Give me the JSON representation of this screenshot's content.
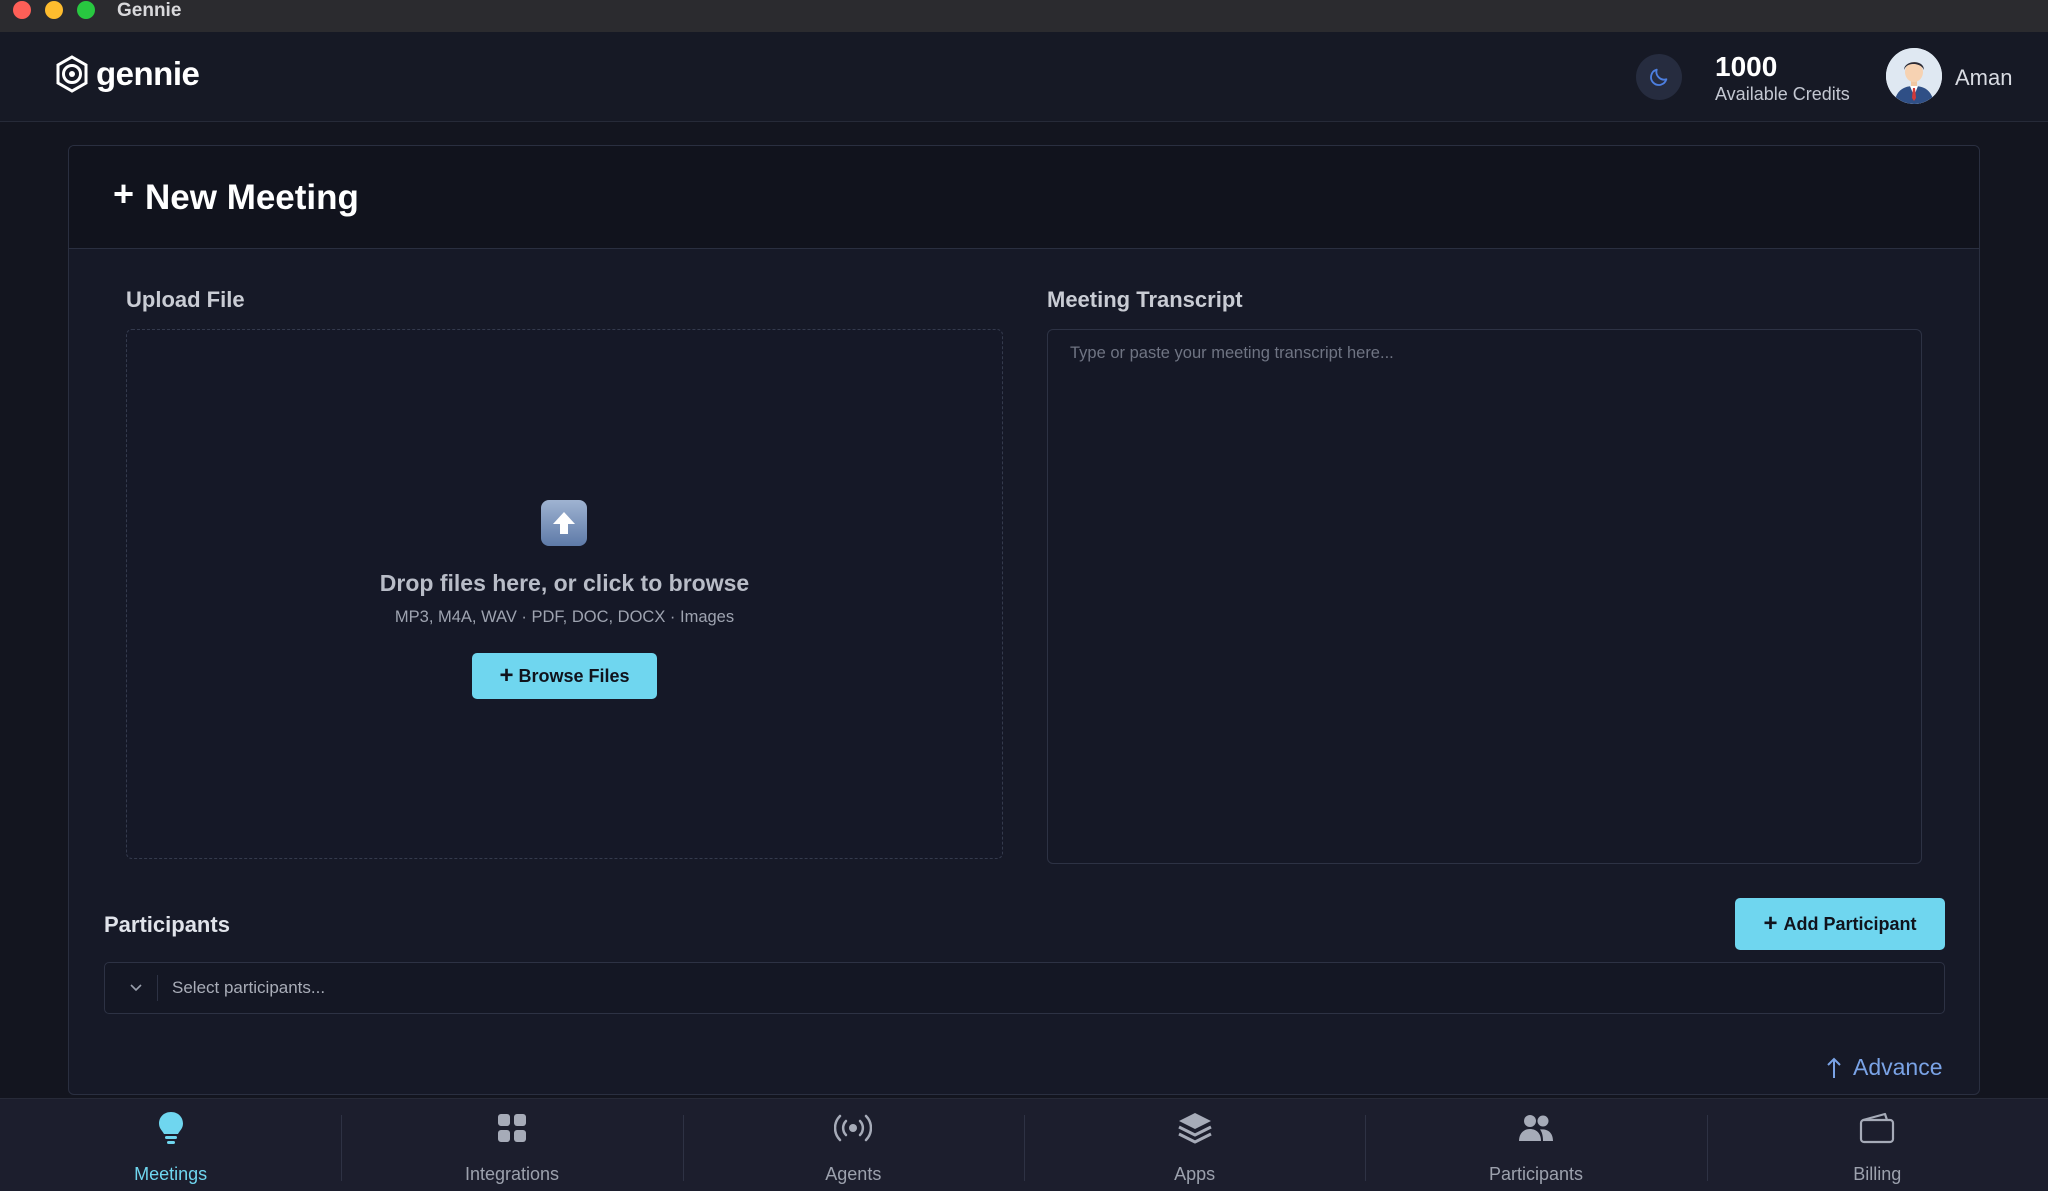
{
  "window": {
    "title": "Gennie"
  },
  "header": {
    "logo_text": "gennie",
    "credits_value": "1000",
    "credits_label": "Available Credits",
    "user_name": "Aman"
  },
  "page": {
    "title": "New Meeting"
  },
  "upload": {
    "label": "Upload File",
    "drop_text": "Drop files here, or click to browse",
    "formats": "MP3, M4A, WAV · PDF, DOC, DOCX · Images",
    "browse_label": "Browse Files"
  },
  "transcript": {
    "label": "Meeting Transcript",
    "placeholder": "Type or paste your meeting transcript here...",
    "value": ""
  },
  "participants": {
    "label": "Participants",
    "add_label": "Add Participant",
    "select_placeholder": "Select participants..."
  },
  "advance_label": "Advance",
  "nav": {
    "items": [
      {
        "label": "Meetings",
        "icon": "lightbulb-icon",
        "active": true
      },
      {
        "label": "Integrations",
        "icon": "grid-icon",
        "active": false
      },
      {
        "label": "Agents",
        "icon": "broadcast-icon",
        "active": false
      },
      {
        "label": "Apps",
        "icon": "layers-icon",
        "active": false
      },
      {
        "label": "Participants",
        "icon": "users-icon",
        "active": false
      },
      {
        "label": "Billing",
        "icon": "wallet-icon",
        "active": false
      }
    ]
  },
  "colors": {
    "accent": "#6fd6ef",
    "link": "#7aa3e6",
    "background": "#13151f"
  }
}
